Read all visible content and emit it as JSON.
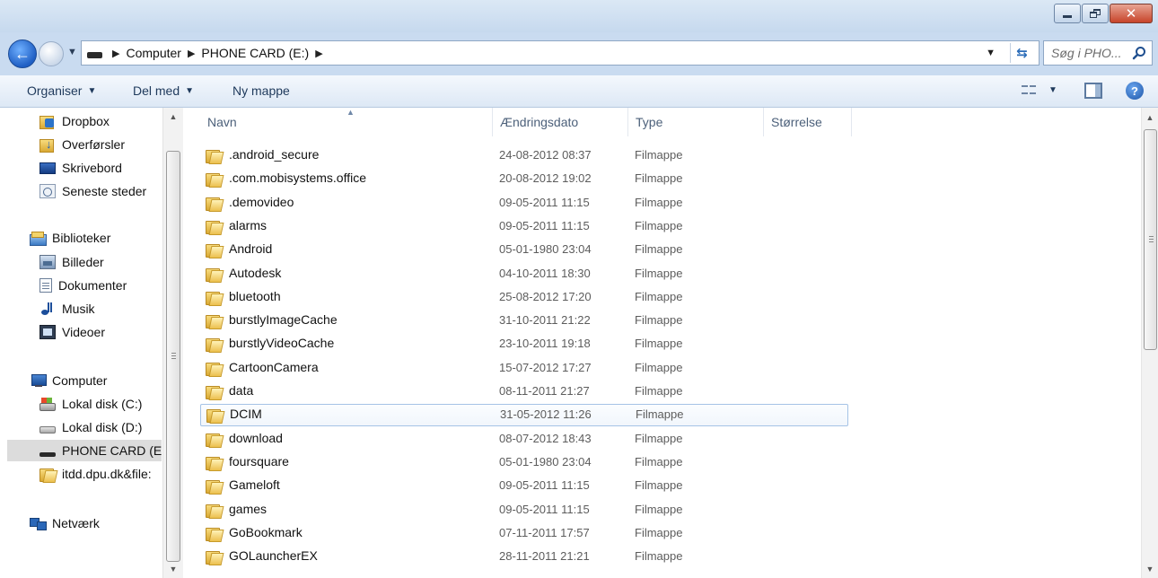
{
  "window": {
    "minimize_icon": "minimize-icon",
    "maximize_icon": "restore-icon",
    "close_icon": "close-icon"
  },
  "address": {
    "breadcrumbs": [
      "Computer",
      "PHONE CARD (E:)"
    ],
    "search_placeholder": "Søg i PHO..."
  },
  "toolbar": {
    "organize_label": "Organiser",
    "share_label": "Del med",
    "new_folder_label": "Ny mappe"
  },
  "nav": {
    "favorites": [
      {
        "label": "Dropbox",
        "icon": "dropbox-folder-icon"
      },
      {
        "label": "Overførsler",
        "icon": "downloads-folder-icon"
      },
      {
        "label": "Skrivebord",
        "icon": "desktop-icon"
      },
      {
        "label": "Seneste steder",
        "icon": "recent-places-icon"
      }
    ],
    "libraries": {
      "label": "Biblioteker",
      "icon": "libraries-icon"
    },
    "library_items": [
      {
        "label": "Billeder",
        "icon": "pictures-icon"
      },
      {
        "label": "Dokumenter",
        "icon": "documents-icon"
      },
      {
        "label": "Musik",
        "icon": "music-icon"
      },
      {
        "label": "Videoer",
        "icon": "videos-icon"
      }
    ],
    "computer": {
      "label": "Computer",
      "icon": "computer-icon"
    },
    "computer_items": [
      {
        "label": "Lokal disk (C:)",
        "icon": "system-disk-icon"
      },
      {
        "label": "Lokal disk (D:)",
        "icon": "disk-icon"
      },
      {
        "label": "PHONE CARD (E:",
        "icon": "phone-card-icon",
        "selected": true
      },
      {
        "label": "itdd.dpu.dk&file:",
        "icon": "folder-icon"
      }
    ],
    "network": {
      "label": "Netværk",
      "icon": "network-icon"
    }
  },
  "columns": {
    "name": "Navn",
    "date": "Ændringsdato",
    "type": "Type",
    "size": "Størrelse"
  },
  "files": [
    {
      "name": ".android_secure",
      "date": "24-08-2012 08:37",
      "type": "Filmappe"
    },
    {
      "name": ".com.mobisystems.office",
      "date": "20-08-2012 19:02",
      "type": "Filmappe"
    },
    {
      "name": ".demovideo",
      "date": "09-05-2011 11:15",
      "type": "Filmappe"
    },
    {
      "name": "alarms",
      "date": "09-05-2011 11:15",
      "type": "Filmappe"
    },
    {
      "name": "Android",
      "date": "05-01-1980 23:04",
      "type": "Filmappe"
    },
    {
      "name": "Autodesk",
      "date": "04-10-2011 18:30",
      "type": "Filmappe"
    },
    {
      "name": "bluetooth",
      "date": "25-08-2012 17:20",
      "type": "Filmappe"
    },
    {
      "name": "burstlyImageCache",
      "date": "31-10-2011 21:22",
      "type": "Filmappe"
    },
    {
      "name": "burstlyVideoCache",
      "date": "23-10-2011 19:18",
      "type": "Filmappe"
    },
    {
      "name": "CartoonCamera",
      "date": "15-07-2012 17:27",
      "type": "Filmappe"
    },
    {
      "name": "data",
      "date": "08-11-2011 21:27",
      "type": "Filmappe"
    },
    {
      "name": "DCIM",
      "date": "31-05-2012 11:26",
      "type": "Filmappe",
      "hover": true
    },
    {
      "name": "download",
      "date": "08-07-2012 18:43",
      "type": "Filmappe"
    },
    {
      "name": "foursquare",
      "date": "05-01-1980 23:04",
      "type": "Filmappe"
    },
    {
      "name": "Gameloft",
      "date": "09-05-2011 11:15",
      "type": "Filmappe"
    },
    {
      "name": "games",
      "date": "09-05-2011 11:15",
      "type": "Filmappe"
    },
    {
      "name": "GoBookmark",
      "date": "07-11-2011 17:57",
      "type": "Filmappe"
    },
    {
      "name": "GOLauncherEX",
      "date": "28-11-2011 21:21",
      "type": "Filmappe"
    }
  ]
}
